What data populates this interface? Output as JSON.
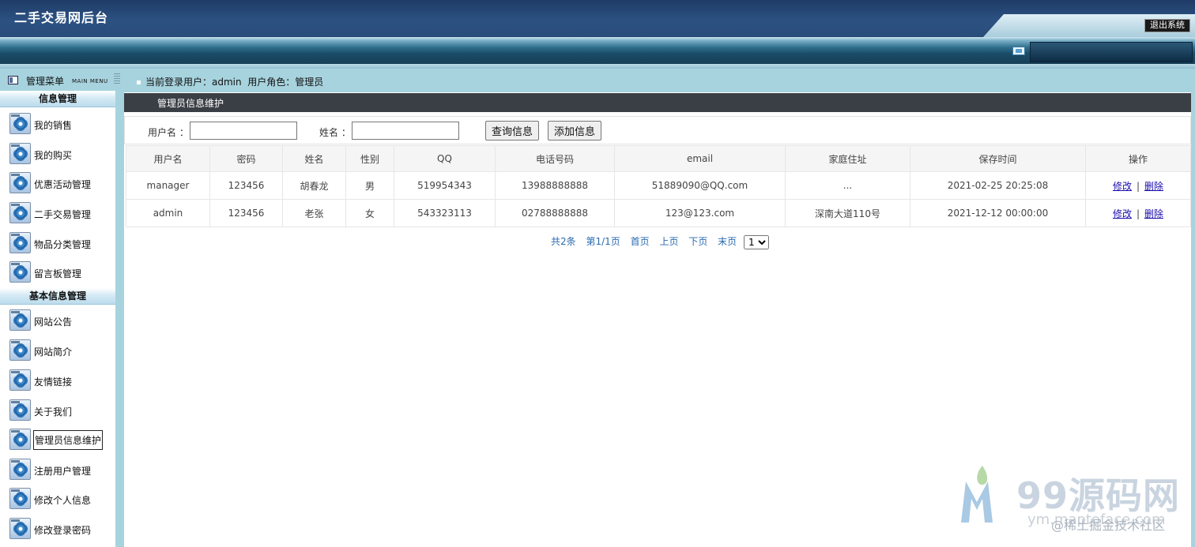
{
  "app": {
    "title": "二手交易网后台",
    "logout_label": "退出系统"
  },
  "sidebar": {
    "title": "管理菜单",
    "subtitle": "MAIN MENU",
    "groups": [
      {
        "title": "信息管理",
        "items": [
          "我的销售",
          "我的购买",
          "优惠活动管理",
          "二手交易管理",
          "物品分类管理",
          "留言板管理"
        ]
      },
      {
        "title": "基本信息管理",
        "items": [
          "网站公告",
          "网站简介",
          "友情链接",
          "关于我们",
          "管理员信息维护",
          "注册用户管理",
          "修改个人信息",
          "修改登录密码"
        ]
      }
    ],
    "active_item": "管理员信息维护"
  },
  "breadcrumb": {
    "user_label": "当前登录用户：",
    "user": "admin",
    "role_label": "用户角色：",
    "role": "管理员"
  },
  "panel": {
    "title": "管理员信息维护"
  },
  "search": {
    "username_label": "用户名 ：",
    "username_value": "",
    "name_label": "姓名 ：",
    "name_value": "",
    "query_button": "查询信息",
    "add_button": "添加信息"
  },
  "table": {
    "headers": [
      "用户名",
      "密码",
      "姓名",
      "性别",
      "QQ",
      "电话号码",
      "email",
      "家庭住址",
      "保存时间",
      "操作"
    ],
    "rows": [
      [
        "manager",
        "123456",
        "胡春龙",
        "男",
        "519954343",
        "13988888888",
        "51889090@QQ.com",
        "...",
        "2021-02-25 20:25:08"
      ],
      [
        "admin",
        "123456",
        "老张",
        "女",
        "543323113",
        "02788888888",
        "123@123.com",
        "深南大道110号",
        "2021-12-12 00:00:00"
      ]
    ],
    "actions": {
      "edit": "修改",
      "separator": "|",
      "delete": "删除"
    }
  },
  "pagination": {
    "total": "共2条",
    "page_info": "第1/1页",
    "first": "首页",
    "prev": "上页",
    "next": "下页",
    "last": "末页",
    "selected_page": "1"
  },
  "watermark": {
    "brand": "99源码网",
    "url": "ym.maptoface.com",
    "credit": "@稀土掘金技术社区"
  }
}
